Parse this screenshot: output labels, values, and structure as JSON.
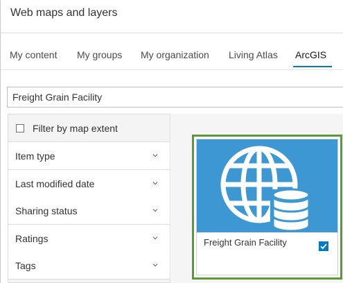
{
  "header": {
    "title": "Web maps and layers"
  },
  "tabs": [
    {
      "label": "My content",
      "active": false
    },
    {
      "label": "My groups",
      "active": false
    },
    {
      "label": "My organization",
      "active": false
    },
    {
      "label": "Living Atlas",
      "active": false
    },
    {
      "label": "ArcGIS",
      "active": true
    }
  ],
  "search": {
    "value": "Freight Grain Facility"
  },
  "filters": {
    "extent_label": "Filter by map extent",
    "extent_checked": false,
    "sections": [
      {
        "label": "Item type",
        "icon": "chevron-down-icon"
      },
      {
        "label": "Last modified date",
        "icon": "chevron-down-icon"
      },
      {
        "label": "Sharing status",
        "icon": "chevron-down-icon"
      },
      {
        "label": "Ratings",
        "icon": "chevron-down-icon"
      },
      {
        "label": "Tags",
        "icon": "chevron-down-icon"
      }
    ]
  },
  "results": {
    "items": [
      {
        "title": "Freight Grain Facility",
        "selected": true,
        "thumbnail_icon": "globe-database-icon"
      }
    ]
  },
  "colors": {
    "accent": "#007ac2",
    "thumbnail_bg": "#3c97d3",
    "selection_highlight": "#5a9a32"
  }
}
